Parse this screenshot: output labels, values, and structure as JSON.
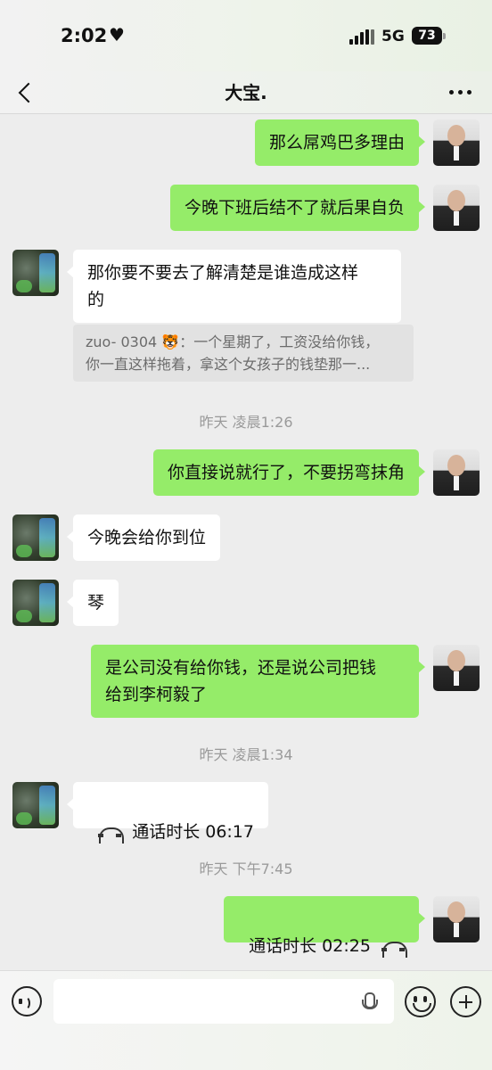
{
  "status_bar": {
    "time": "2:02",
    "heart": "♥",
    "network": "5G",
    "battery": "73"
  },
  "header": {
    "title": "大宝."
  },
  "messages": [
    {
      "side": "self",
      "type": "text",
      "text": "那么屌鸡巴多理由"
    },
    {
      "side": "self",
      "type": "text",
      "text": "今晚下班后结不了就后果自负"
    },
    {
      "side": "other",
      "type": "text",
      "text": "那你要不要去了解清楚是谁造成这样\n的",
      "quote": {
        "line1": "zuo- 0304 🐯：一个星期了，工资没给你钱，",
        "line2": "你一直这样拖着，拿这个女孩子的钱垫那一..."
      }
    },
    {
      "type": "timestamp",
      "text": "昨天 凌晨1:26"
    },
    {
      "side": "self",
      "type": "text",
      "text": "你直接说就行了，不要拐弯抹角"
    },
    {
      "side": "other",
      "type": "text",
      "text": "今晚会给你到位"
    },
    {
      "side": "other",
      "type": "text",
      "text": "琴"
    },
    {
      "side": "self",
      "type": "text",
      "text": "是公司没有给你钱，还是说公司把钱\n给到李柯毅了"
    },
    {
      "type": "timestamp",
      "text": "昨天 凌晨1:34"
    },
    {
      "side": "other",
      "type": "call",
      "text": "通话时长 06:17",
      "icon": "phone-hangup-icon"
    },
    {
      "type": "timestamp",
      "text": "昨天 下午7:45"
    },
    {
      "side": "self",
      "type": "call",
      "text": "通话时长 02:25",
      "icon": "phone-hangup-icon"
    }
  ],
  "input_bar": {
    "placeholder": "",
    "value": ""
  },
  "colors": {
    "self_bubble": "#95ec69",
    "other_bubble": "#ffffff",
    "chat_background": "#ededed"
  }
}
